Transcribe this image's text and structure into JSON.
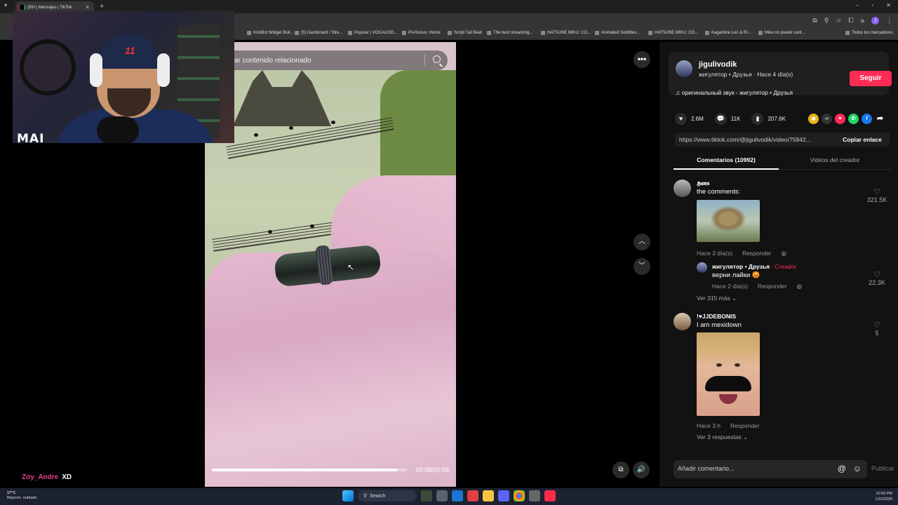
{
  "browser": {
    "tab_title": "(99+) Mensajes | TikTok",
    "bookmarks": [
      "KickBot Widget Buil...",
      "(5) Dashboard / Stre...",
      "Popular | VOCALOID...",
      "PreSonus: Home",
      "Script Tail Beat",
      "The best streaming...",
      "HATSUNE MIKU: CO...",
      "Animated Subtitles...",
      "HATSUNE MIKU: CO...",
      "Kagamine Len & Ri...",
      "Miku no puede cant..."
    ],
    "all_bookmarks": "Todos los marcadores",
    "profile_initial": "J"
  },
  "webcam": {
    "logo": "MAI",
    "cap_number": "11"
  },
  "video": {
    "search_placeholder": "ar contenido relacionado",
    "time": "00:08/00:09",
    "progress": 0.95
  },
  "author": {
    "name": "jigulivodik",
    "subtitle": "жигулятор • Друзья · Hace 4 día(s)",
    "follow_label": "Seguir",
    "music": "оригинальный звук - жигулятор • Друзья"
  },
  "stats": {
    "likes": "2.6M",
    "comments": "11K",
    "saves": "207.6K"
  },
  "link": {
    "url": "https://www.tiktok.com/@jigulivodik/video/75942...",
    "copy_label": "Copiar enlace"
  },
  "tabs": {
    "comments": "Comentarios (10992)",
    "creator_videos": "Videos del creador"
  },
  "comments": [
    {
      "name": "𝕳𝖆𝖓𝖘",
      "text": "the comments:",
      "time": "Hace 3 día(s)",
      "reply": "Responder",
      "likes": "321.5K",
      "sub_reply": {
        "name": "жигулятор • Друзья",
        "badge": "· Creador",
        "text": "верни лайки 😡",
        "time": "Hace 2 día(s)",
        "reply": "Responder",
        "likes": "22.3K"
      },
      "more": "Ver 315 más"
    },
    {
      "name": "!♥JJDEBONIS",
      "text": "I am mexidown",
      "time": "Hace 3 h",
      "reply": "Responder",
      "likes": "5",
      "more": "Ver 3 respuestas"
    }
  ],
  "composer": {
    "placeholder": "Añadir comentario...",
    "publish": "Publicar"
  },
  "chat": {
    "user": "Zoy_Andre",
    "message": "XD"
  },
  "taskbar": {
    "temp": "17°C",
    "weather": "Mayorm. nublado",
    "search": "Search",
    "time": "10:56 PM",
    "date": "1/15/2026"
  },
  "colors": {
    "accent": "#fe2c55",
    "chat_user": "#e83e8c"
  }
}
